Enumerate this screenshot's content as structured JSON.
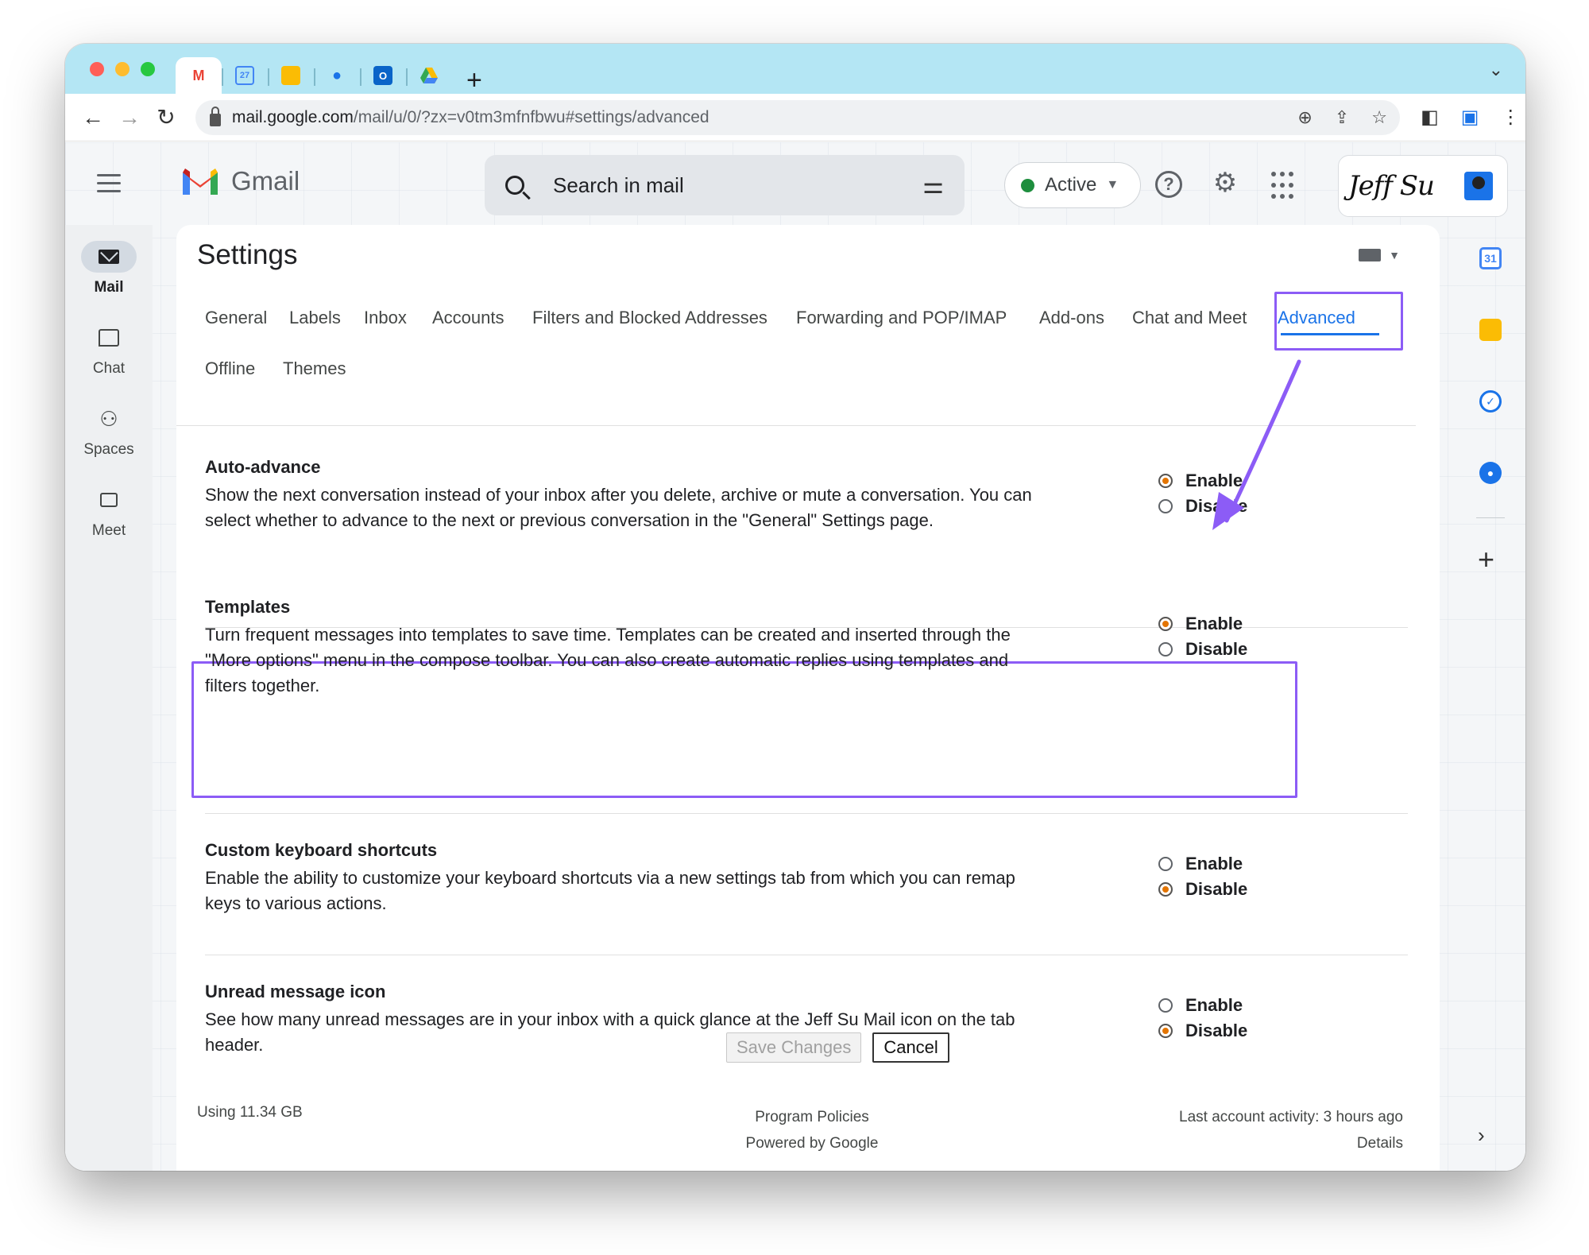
{
  "browser": {
    "tabs": [
      {
        "icon": "gmail-icon",
        "active": true
      },
      {
        "icon": "calendar-icon",
        "label": "27"
      },
      {
        "icon": "keep-icon"
      },
      {
        "icon": "contacts-icon"
      },
      {
        "icon": "outlook-icon"
      },
      {
        "icon": "drive-icon"
      }
    ],
    "new_tab": "+",
    "url_host": "mail.google.com",
    "url_path": "/mail/u/0/?zx=v0tm3mfnfbwu#settings/advanced"
  },
  "header": {
    "app_name": "Gmail",
    "search_placeholder": "Search in mail",
    "status": "Active",
    "help_glyph": "?",
    "signature": "Jeff Su"
  },
  "leftnav": {
    "items": [
      {
        "label": "Mail",
        "icon": "mail-icon",
        "active": true
      },
      {
        "label": "Chat",
        "icon": "chat-icon"
      },
      {
        "label": "Spaces",
        "icon": "spaces-icon"
      },
      {
        "label": "Meet",
        "icon": "meet-icon"
      }
    ]
  },
  "sidepanel": {
    "calendar_label": "31",
    "plus": "+",
    "expand": "›"
  },
  "settings": {
    "title": "Settings",
    "tabs": [
      "General",
      "Labels",
      "Inbox",
      "Accounts",
      "Filters and Blocked Addresses",
      "Forwarding and POP/IMAP",
      "Add-ons",
      "Chat and Meet",
      "Advanced",
      "Offline",
      "Themes"
    ],
    "active_tab": "Advanced",
    "items": [
      {
        "title": "Auto-advance",
        "description": "Show the next conversation instead of your inbox after you delete, archive or mute a conversation. You can select whether to advance to the next or previous conversation in the \"General\" Settings page.",
        "enable_label": "Enable",
        "disable_label": "Disable",
        "selected": "Enable"
      },
      {
        "title": "Templates",
        "description": "Turn frequent messages into templates to save time. Templates can be created and inserted through the \"More options\" menu in the compose toolbar. You can also create automatic replies using templates and filters together.",
        "enable_label": "Enable",
        "disable_label": "Disable",
        "selected": "Enable"
      },
      {
        "title": "Custom keyboard shortcuts",
        "description": "Enable the ability to customize your keyboard shortcuts via a new settings tab from which you can remap keys to various actions.",
        "enable_label": "Enable",
        "disable_label": "Disable",
        "selected": "Disable"
      },
      {
        "title": "Unread message icon",
        "description": "See how many unread messages are in your inbox with a quick glance at the Jeff Su Mail icon on the tab header.",
        "enable_label": "Enable",
        "disable_label": "Disable",
        "selected": "Disable"
      }
    ],
    "save_label": "Save Changes",
    "cancel_label": "Cancel"
  },
  "footer": {
    "storage": "Using 11.34 GB",
    "program_policies": "Program Policies",
    "powered_by": "Powered by Google",
    "last_activity": "Last account activity: 3 hours ago",
    "details": "Details"
  },
  "colors": {
    "highlight": "#8c5cf6",
    "accent": "#1a73e8",
    "radio_selected": "#e37400",
    "status_active": "#1e8e3e"
  }
}
